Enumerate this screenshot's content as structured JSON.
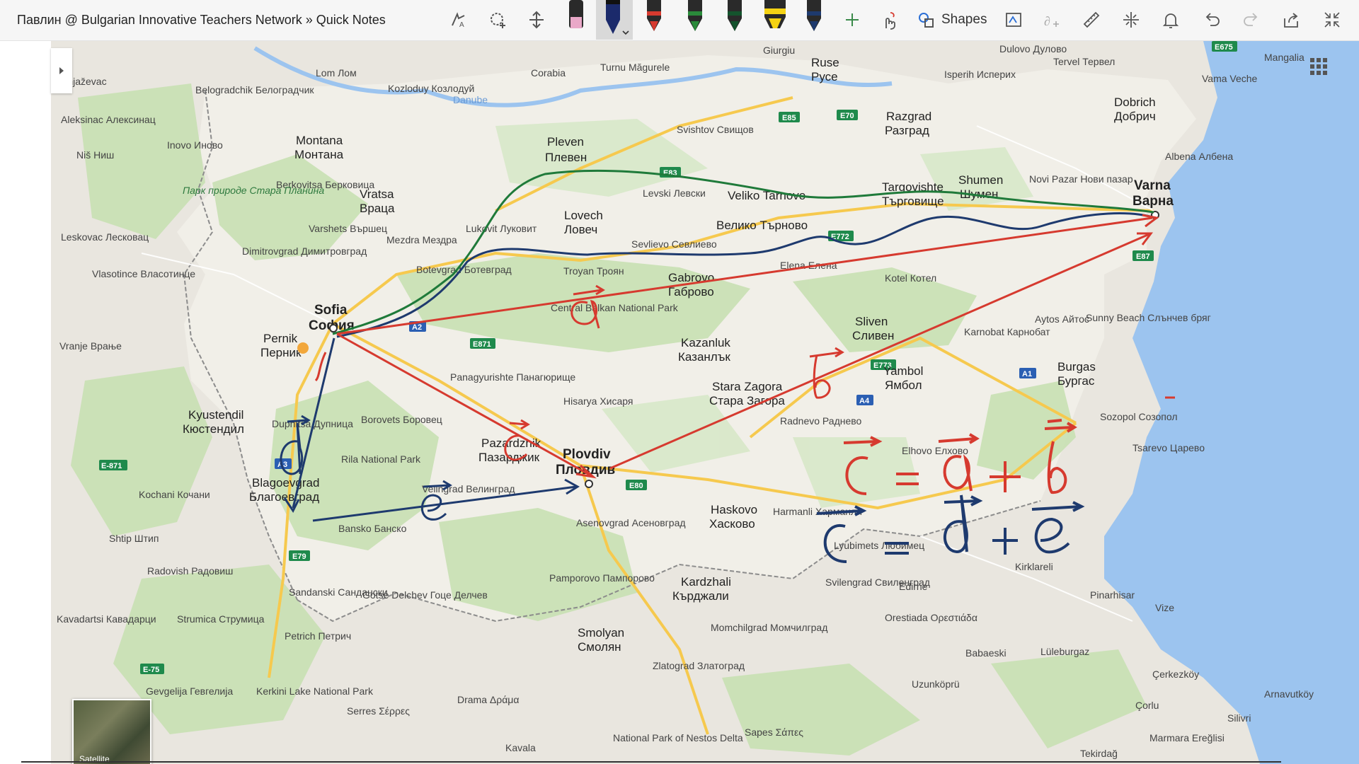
{
  "window": {
    "title": "Павлин @ Bulgarian Innovative Teachers Network » Quick Notes"
  },
  "toolbar": {
    "items": [
      {
        "icon": "lasso-select-icon"
      },
      {
        "icon": "lasso-add-icon"
      },
      {
        "icon": "add-space-icon"
      },
      {
        "icon": "highlighter-pink-icon"
      },
      {
        "icon": "pen-navy-selected-icon"
      },
      {
        "icon": "pen-red-icon"
      },
      {
        "icon": "pen-green-icon"
      },
      {
        "icon": "pen-darkgreen-icon"
      },
      {
        "icon": "highlighter-yellow-icon"
      },
      {
        "icon": "pen-darkblue-icon"
      },
      {
        "icon": "add-pen-icon"
      },
      {
        "icon": "touch-draw-icon"
      },
      {
        "icon": "ink-to-shape-icon"
      },
      {
        "icon": "ink-to-text-icon"
      },
      {
        "icon": "ruler-icon"
      },
      {
        "icon": "math-icon"
      },
      {
        "icon": "bell-icon"
      },
      {
        "icon": "undo-icon"
      },
      {
        "icon": "redo-icon"
      },
      {
        "icon": "share-icon"
      },
      {
        "icon": "collapse-icon"
      }
    ],
    "shapes_label": "Shapes",
    "colors": {
      "pink": "#e9a8c8",
      "navy": "#1b2a6b",
      "red": "#d63a2f",
      "green": "#2a8a3a",
      "darkgreen": "#14532d",
      "yellow": "#f5d314",
      "darkblue": "#1e3a6e"
    }
  },
  "map": {
    "cities": [
      {
        "name": "Sofia",
        "alt": "София"
      },
      {
        "name": "Plovdiv",
        "alt": "Пловдив"
      },
      {
        "name": "Varna",
        "alt": "Варна"
      },
      {
        "name": "Burgas",
        "alt": "Бургас"
      },
      {
        "name": "Pleven",
        "alt": "Плевен"
      },
      {
        "name": "Lovech",
        "alt": "Ловеч"
      },
      {
        "name": "Veliko Tarnovo",
        "alt": "Велико Търново"
      },
      {
        "name": "Gabrovo",
        "alt": "Габрово"
      },
      {
        "name": "Kazanluk",
        "alt": "Казанлък"
      },
      {
        "name": "Stara Zagora",
        "alt": "Стара Загора"
      },
      {
        "name": "Sliven",
        "alt": "Сливен"
      },
      {
        "name": "Yambol",
        "alt": "Ямбол"
      },
      {
        "name": "Shumen",
        "alt": "Шумен"
      },
      {
        "name": "Targovishte",
        "alt": "Търговище"
      },
      {
        "name": "Razgrad",
        "alt": "Разград"
      },
      {
        "name": "Dobrich",
        "alt": "Добрич"
      },
      {
        "name": "Ruse",
        "alt": "Русе"
      },
      {
        "name": "Pernik",
        "alt": "Перник"
      },
      {
        "name": "Kyustendil",
        "alt": "Кюстендил"
      },
      {
        "name": "Blagoevgrad",
        "alt": "Благоевград"
      },
      {
        "name": "Pazardzhik",
        "alt": "Пазарджик"
      },
      {
        "name": "Haskovo",
        "alt": "Хасково"
      },
      {
        "name": "Kardzhali",
        "alt": "Кърджали"
      },
      {
        "name": "Smolyan",
        "alt": "Смолян"
      },
      {
        "name": "Montana",
        "alt": "Монтана"
      },
      {
        "name": "Vratsa",
        "alt": "Враца"
      }
    ],
    "places": [
      "Giurgiu",
      "Turnu Măgurele",
      "Corabia",
      "Lom Лом",
      "Kozloduy Козлодуй",
      "Mangalia",
      "Vama Veche",
      "Dulovo Дулово",
      "Tervel Тервел",
      "Isperih Исперих",
      "Svishtov Свищов",
      "Levski Левски",
      "Troyan Троян",
      "Sevlievo Севлиево",
      "Central Balkan National Park",
      "Botevgrad Ботевград",
      "Lukovit Луковит",
      "Elena Елена",
      "Kotel Котел",
      "Aytos Айтос",
      "Karnobat Карнобат",
      "Sunny Beach Слънчев бряг",
      "Albena Албена",
      "Novi Pazar Нови пазар",
      "Belogradchik Белоградчик",
      "Berkovitsa Берковица",
      "Varshets Вършец",
      "Mezdra Мездра",
      "Dimitrovgrad Димитровград",
      "Leskovac Лесковац",
      "Vlasotince Власотинце",
      "Niš Ниш",
      "Aleksinac Алексинац",
      "Knjaževac",
      "Inovo Иново",
      "Vranje Врање",
      "Kochani Кочани",
      "Shtip Штип",
      "Radovish Радовиш",
      "Kavadartsi Кавадарци",
      "Strumica Струмица",
      "Gevgelija Гевгелија",
      "Kerkini Lake National Park",
      "Serres Σέρρες",
      "Drama Δράμα",
      "Kavala",
      "Petrich Петрич",
      "Sandanski Сандански",
      "Gotse Delchev Гоце Делчев",
      "Bansko Банско",
      "Rila National Park",
      "Velingrad Велинград",
      "Panagyurishte Панагюрище",
      "Hisarya Хисаря",
      "Borovets Боровец",
      "Dupnitsa Дупница",
      "Asenovgrad Асеновград",
      "Pamporovo Пампорово",
      "Momchilgrad Момчилград",
      "Zlatograd Златоград",
      "National Park of Nestos Delta",
      "Harmanli Харманли",
      "Lyubimets Любимец",
      "Svilengrad Свиленград",
      "Edirne",
      "Orestiada Ορεστιάδα",
      "Kirklareli",
      "Pinarhisar",
      "Vize",
      "Lüleburgaz",
      "Babaeski",
      "Uzunköprü",
      "Çerkezköy",
      "Çorlu",
      "Silivri",
      "Marmara Ereğlisi",
      "Tekirdağ",
      "Arnavutköy",
      "Radnevo Раднево",
      "Elhovo Елхово",
      "Sozopol Созопол",
      "Tsarevo Царево",
      "Sapes Σάπες",
      "Danube",
      "Парк природе Стара Планина"
    ],
    "road_badges": [
      "E85",
      "E70",
      "E83",
      "E772",
      "E87",
      "E79",
      "E871",
      "E80",
      "E773",
      "A1",
      "A2",
      "A3",
      "A4",
      "E675",
      "E-75",
      "E-871"
    ]
  },
  "annotations": {
    "vectors": [
      "a",
      "b",
      "c",
      "d",
      "e"
    ],
    "equation_red": "c = a + b",
    "equation_blue": "c = d + e"
  },
  "satellite": {
    "label": "Satellite"
  }
}
